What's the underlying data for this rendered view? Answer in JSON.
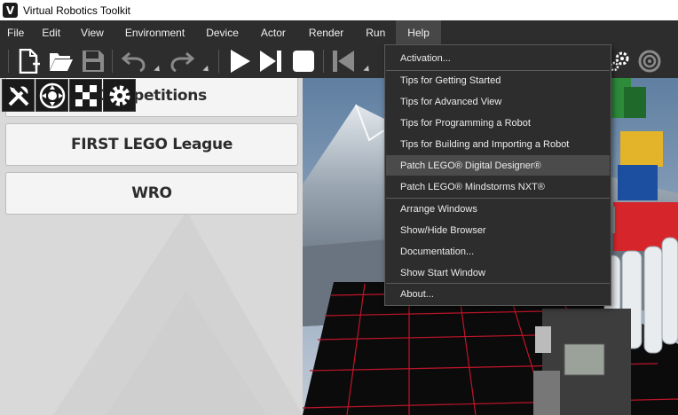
{
  "window": {
    "title": "Virtual Robotics Toolkit",
    "logo_letter": "V"
  },
  "menubar": {
    "items": [
      "File",
      "Edit",
      "View",
      "Environment",
      "Device",
      "Actor",
      "Render",
      "Run",
      "Help"
    ],
    "active": "Help"
  },
  "toolbar": {
    "icons": [
      "new-file-icon",
      "open-folder-icon",
      "save-icon",
      "undo-icon",
      "redo-icon",
      "play-icon",
      "step-forward-icon",
      "stop-icon",
      "skip-back-icon",
      "settings-gears-icon",
      "target-icon"
    ]
  },
  "left_panel": {
    "buttons": [
      {
        "label": "Competitions"
      },
      {
        "label": "FIRST LEGO League"
      },
      {
        "label": "WRO"
      }
    ],
    "tabs": [
      "tools-icon",
      "gamepad-icon",
      "checkerboard-icon",
      "gear-icon"
    ]
  },
  "help_menu": {
    "items": [
      {
        "label": "Activation..."
      },
      {
        "label": "Tips for Getting Started"
      },
      {
        "label": "Tips for Advanced View"
      },
      {
        "label": "Tips for Programming a Robot"
      },
      {
        "label": "Tips for Building and Importing a Robot"
      },
      {
        "label": "Patch LEGO® Digital Designer®"
      },
      {
        "label": "Patch LEGO® Mindstorms NXT®"
      },
      {
        "label": "Arrange Windows"
      },
      {
        "label": "Show/Hide Browser"
      },
      {
        "label": "Documentation..."
      },
      {
        "label": "Show Start Window"
      },
      {
        "label": "About..."
      }
    ],
    "highlighted": "Patch LEGO® Digital Designer®"
  },
  "colors": {
    "menubar_bg": "#2d2d2d",
    "menu_text": "#f0f0f0",
    "panel_bg": "#d9d9d9",
    "highlight": "#4b4b4b",
    "grid_red": "#c0152a"
  }
}
